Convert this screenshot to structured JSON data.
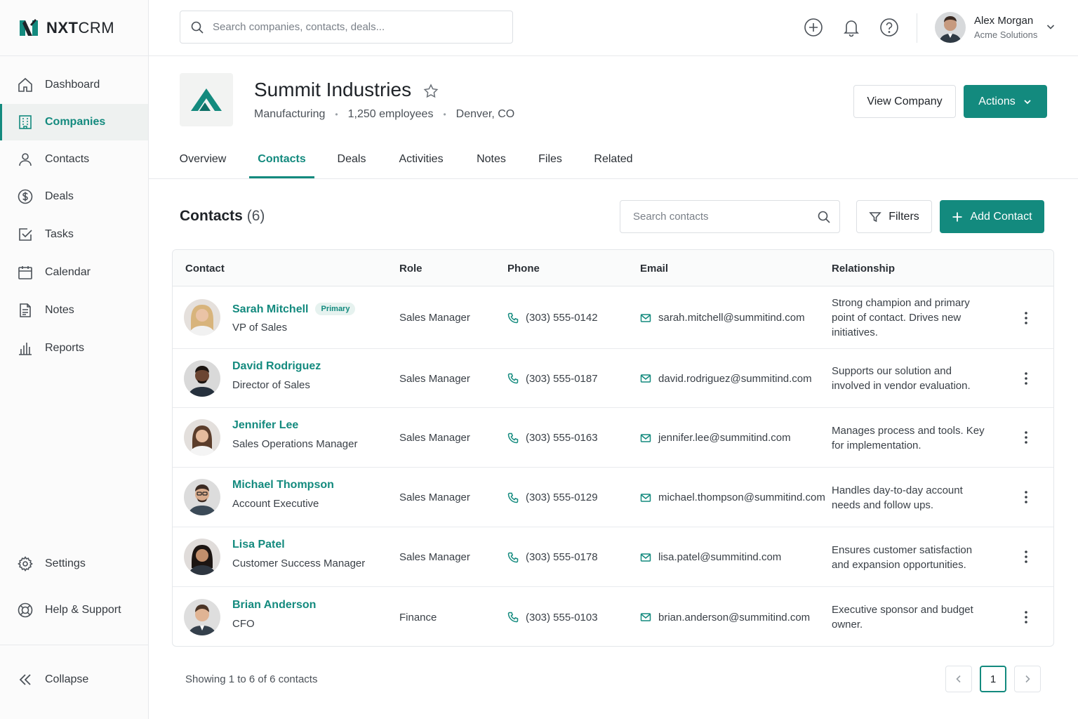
{
  "app": {
    "brand_bold": "NXT",
    "brand_rest": "CRM"
  },
  "colors": {
    "accent": "#138a7e",
    "sidebar_bg": "#fbfbfb",
    "border": "#e4e7ea",
    "badge_bg": "#e6f2ef"
  },
  "sidebar": {
    "items": [
      {
        "label": "Dashboard",
        "icon": "home-icon"
      },
      {
        "label": "Companies",
        "icon": "building-icon",
        "active": true
      },
      {
        "label": "Contacts",
        "icon": "user-icon"
      },
      {
        "label": "Deals",
        "icon": "dollar-icon"
      },
      {
        "label": "Tasks",
        "icon": "checkbox-icon"
      },
      {
        "label": "Calendar",
        "icon": "calendar-icon"
      },
      {
        "label": "Notes",
        "icon": "note-icon"
      },
      {
        "label": "Reports",
        "icon": "bar-chart-icon"
      }
    ],
    "bottom": [
      {
        "label": "Settings",
        "icon": "gear-icon"
      },
      {
        "label": "Help & Support",
        "icon": "lifebuoy-icon"
      }
    ],
    "collapse_label": "Collapse"
  },
  "topbar": {
    "search_placeholder": "Search companies, contacts, deals...",
    "user": {
      "name": "Alex Morgan",
      "org": "Acme Solutions"
    }
  },
  "company": {
    "name": "Summit Industries",
    "industry": "Manufacturing",
    "employees": "1,250 employees",
    "location": "Denver, CO",
    "view_button": "View Company",
    "actions_button": "Actions"
  },
  "tabs": [
    {
      "label": "Overview"
    },
    {
      "label": "Contacts",
      "active": true
    },
    {
      "label": "Deals"
    },
    {
      "label": "Activities"
    },
    {
      "label": "Notes"
    },
    {
      "label": "Files"
    },
    {
      "label": "Related"
    }
  ],
  "contacts_section": {
    "title": "Contacts",
    "count": "(6)",
    "search_placeholder": "Search contacts",
    "filters_label": "Filters",
    "add_label": "Add Contact"
  },
  "table": {
    "columns": [
      "Contact",
      "Role",
      "Phone",
      "Email",
      "Relationship"
    ],
    "rows": [
      {
        "name": "Sarah Mitchell",
        "badge": "Primary",
        "title": "VP of Sales",
        "role": "Sales Manager",
        "phone": "(303) 555-0142",
        "email": "sarah.mitchell@summitind.com",
        "relationship": "Strong champion and primary point of contact. Drives new initiatives."
      },
      {
        "name": "David Rodriguez",
        "badge": "",
        "title": "Director of Sales",
        "role": "Sales Manager",
        "phone": "(303) 555-0187",
        "email": "david.rodriguez@summitind.com",
        "relationship": "Supports our solution and involved in vendor evaluation."
      },
      {
        "name": "Jennifer Lee",
        "badge": "",
        "title": "Sales Operations Manager",
        "role": "Sales Manager",
        "phone": "(303) 555-0163",
        "email": "jennifer.lee@summitind.com",
        "relationship": "Manages process and tools. Key for implementation."
      },
      {
        "name": "Michael Thompson",
        "badge": "",
        "title": "Account Executive",
        "role": "Sales Manager",
        "phone": "(303) 555-0129",
        "email": "michael.thompson@summitind.com",
        "relationship": "Handles day-to-day account needs and follow ups."
      },
      {
        "name": "Lisa Patel",
        "badge": "",
        "title": "Customer Success Manager",
        "role": "Sales Manager",
        "phone": "(303) 555-0178",
        "email": "lisa.patel@summitind.com",
        "relationship": "Ensures customer satisfaction and expansion opportunities."
      },
      {
        "name": "Brian Anderson",
        "badge": "",
        "title": "CFO",
        "role": "Finance",
        "phone": "(303) 555-0103",
        "email": "brian.anderson@summitind.com",
        "relationship": "Executive sponsor and budget owner."
      }
    ]
  },
  "footer": {
    "showing": "Showing 1 to 6 of 6 contacts",
    "current_page": "1"
  }
}
